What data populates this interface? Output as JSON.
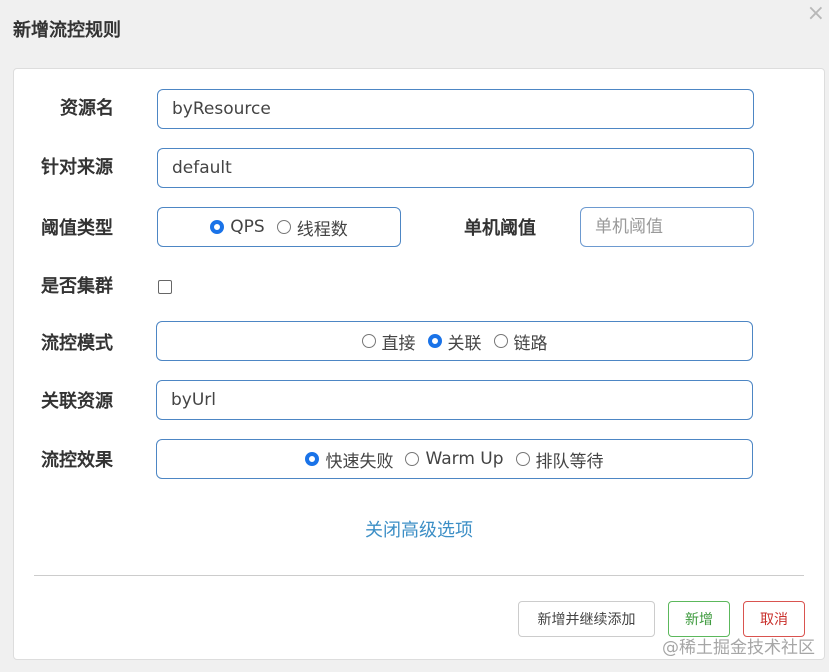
{
  "dialog": {
    "title": "新增流控规则",
    "close": "×"
  },
  "form": {
    "resource_name": {
      "label": "资源名",
      "value": "byResource"
    },
    "limit_app": {
      "label": "针对来源",
      "value": "default"
    },
    "threshold_type": {
      "label": "阈值类型",
      "options": [
        "QPS",
        "线程数"
      ],
      "selected": "QPS"
    },
    "single_threshold": {
      "label": "单机阈值",
      "placeholder": "单机阈值"
    },
    "cluster": {
      "label": "是否集群",
      "checked": false
    },
    "flow_mode": {
      "label": "流控模式",
      "options": [
        "直接",
        "关联",
        "链路"
      ],
      "selected": "关联"
    },
    "ref_resource": {
      "label": "关联资源",
      "value": "byUrl"
    },
    "flow_effect": {
      "label": "流控效果",
      "options": [
        "快速失败",
        "Warm Up",
        "排队等待"
      ],
      "selected": "快速失败"
    },
    "advanced_toggle": "关闭高级选项"
  },
  "buttons": {
    "add_continue": "新增并继续添加",
    "add": "新增",
    "cancel": "取消"
  },
  "watermark": "@稀土掘金技术社区",
  "colors": {
    "accent": "#1a73e8",
    "input_border": "#4d86c4",
    "link": "#3d8fc6",
    "success": "#5cb85c",
    "danger": "#d9534f"
  }
}
